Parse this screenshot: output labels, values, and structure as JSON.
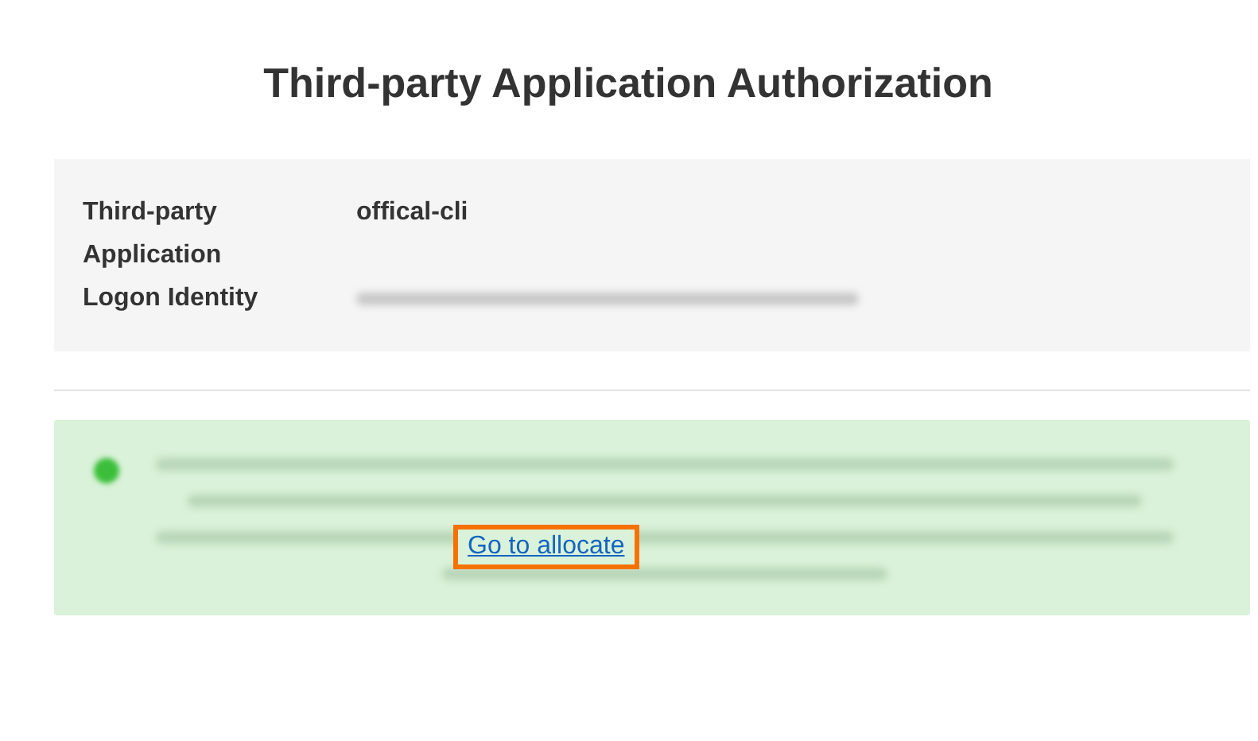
{
  "title": "Third-party Application Authorization",
  "details": [
    {
      "label": "Third-party Application",
      "value": "offical-cli",
      "kind": "text"
    },
    {
      "label": "Logon Identity",
      "kind": "redacted"
    }
  ],
  "notice": {
    "redacted": true,
    "link": "Go to allocate",
    "highlighted": true
  }
}
